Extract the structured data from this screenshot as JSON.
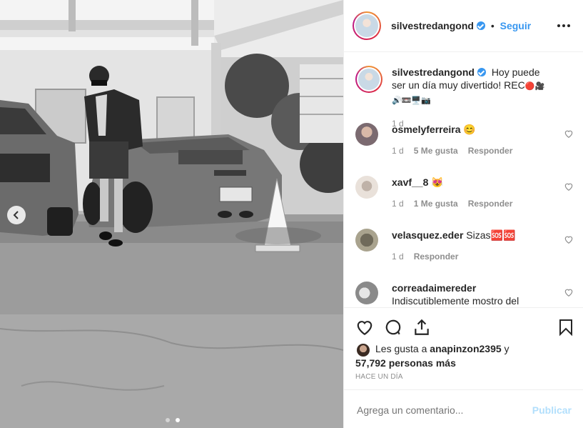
{
  "post": {
    "username": "silvestredangond",
    "follow_separator": "•",
    "follow_label": "Seguir",
    "more_icon": "more-options-icon",
    "caption": "Hoy puede ser un día muy divertido! REC",
    "caption_emojis": "🔴🎥🔊📼🖥️📷",
    "caption_time": "1 d"
  },
  "comments": [
    {
      "username": "osmelyferreira",
      "text": "😊",
      "time": "1 d",
      "likes": "5 Me gusta",
      "reply": "Responder"
    },
    {
      "username": "xavf__8",
      "text": "😻",
      "time": "1 d",
      "likes": "1 Me gusta",
      "reply": "Responder"
    },
    {
      "username": "velasquez.eder",
      "text": "Sizas🆘🆘",
      "time": "1 d",
      "likes": "",
      "reply": "Responder"
    },
    {
      "username": "correadaimereder",
      "text": "Indiscutiblemente mostro del"
    }
  ],
  "likes": {
    "prefix": "Les gusta a",
    "user": "anapinzon2395",
    "joiner": "y",
    "count": "57,792",
    "suffix": "personas más"
  },
  "timestamp": "HACE UN DÍA",
  "add_comment": {
    "placeholder": "Agrega un comentario...",
    "publish": "Publicar"
  },
  "colors": {
    "link": "#3897f0",
    "publish_disabled": "#b2dffc",
    "muted": "#8e8e8e"
  }
}
